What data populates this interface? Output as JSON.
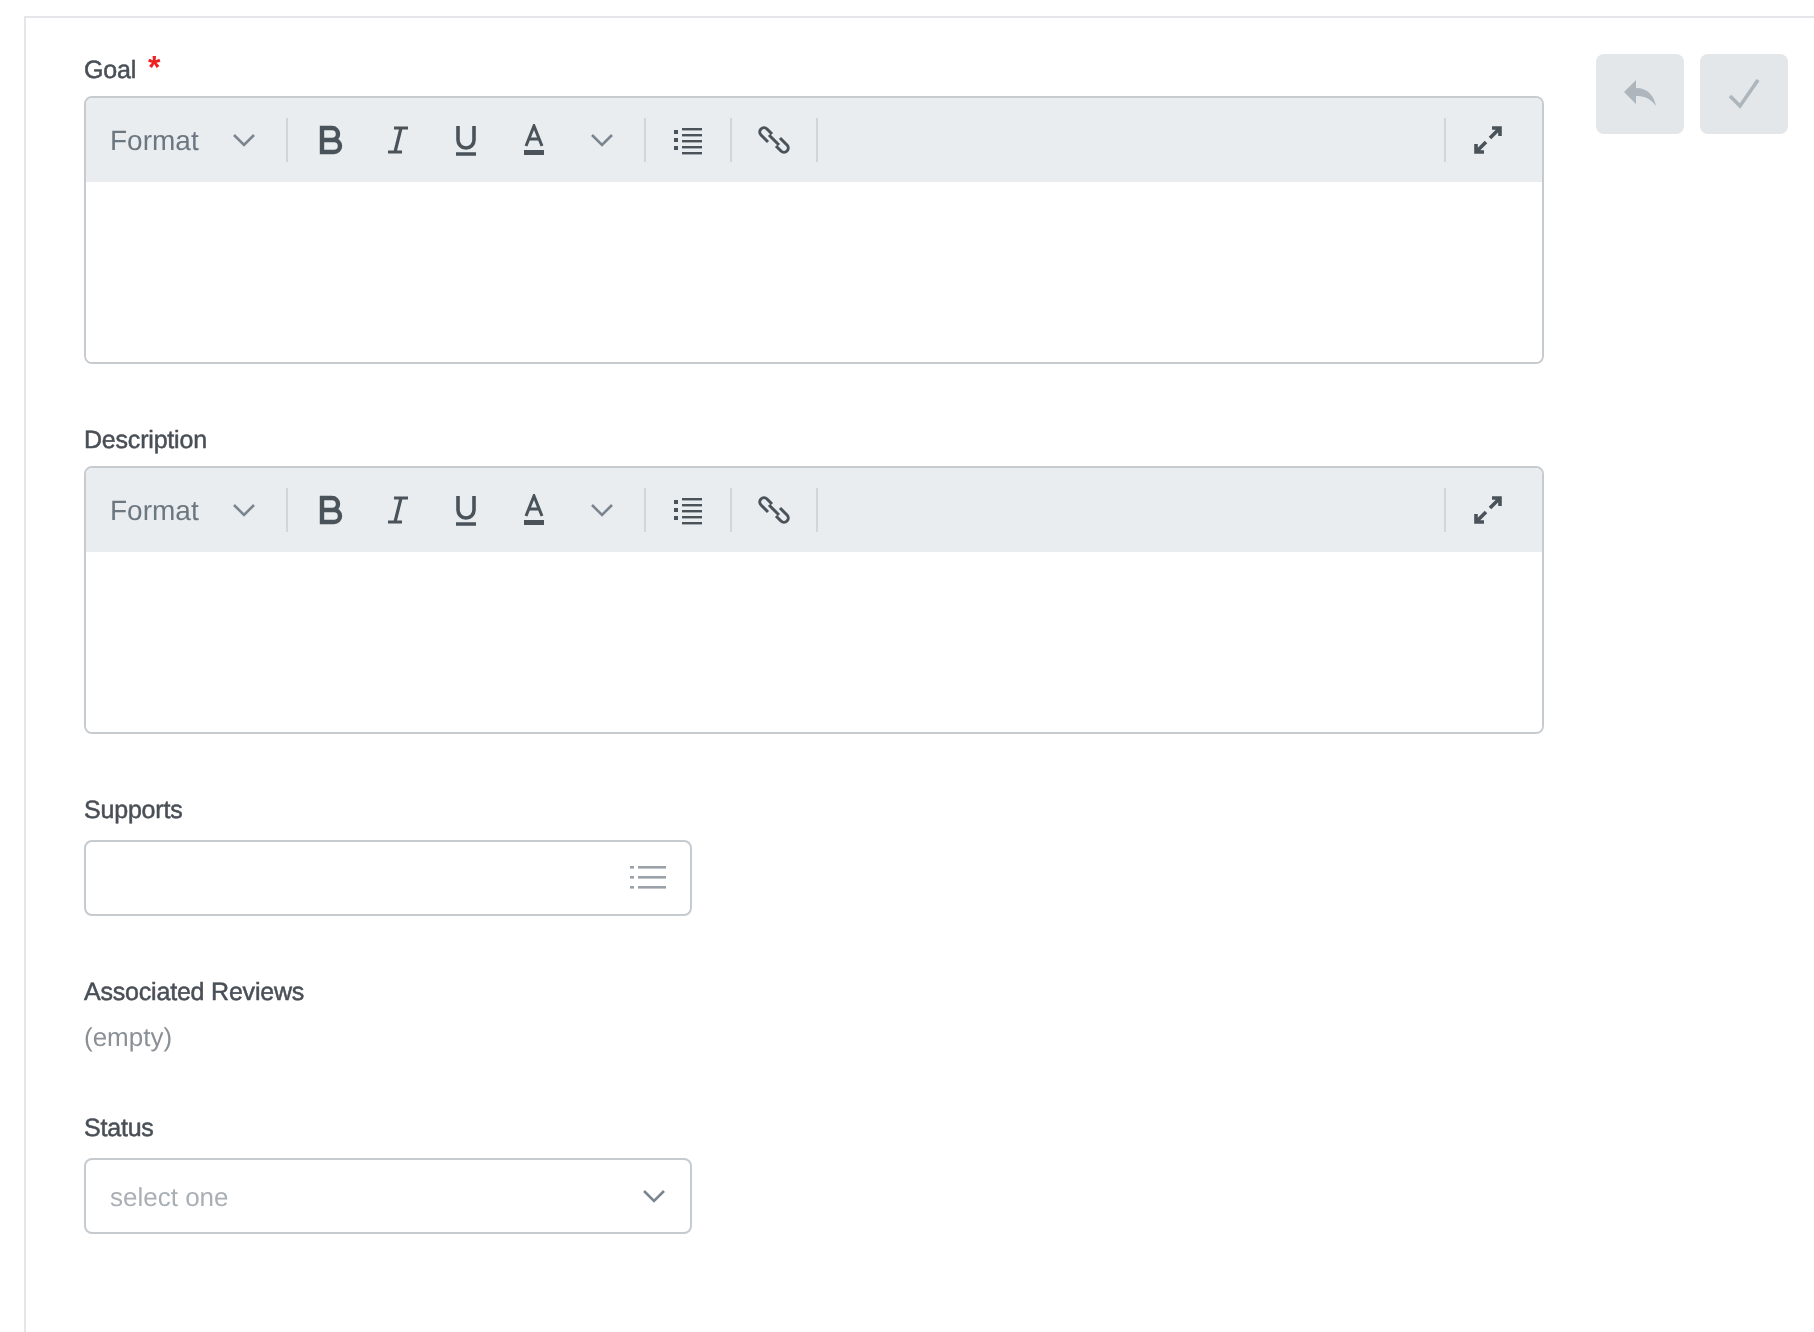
{
  "actions": [
    {
      "kind": "undo"
    },
    {
      "kind": "confirm"
    }
  ],
  "fields": [
    {
      "kind": "richtext",
      "label": "Goal",
      "required_marker": "*",
      "format_label": "Format"
    },
    {
      "kind": "richtext",
      "label": "Description",
      "format_label": "Format"
    },
    {
      "kind": "prompt",
      "label": "Supports"
    },
    {
      "kind": "readonly",
      "label": "Associated Reviews",
      "value": "(empty)"
    },
    {
      "kind": "select",
      "label": "Status",
      "placeholder": "select one"
    }
  ]
}
